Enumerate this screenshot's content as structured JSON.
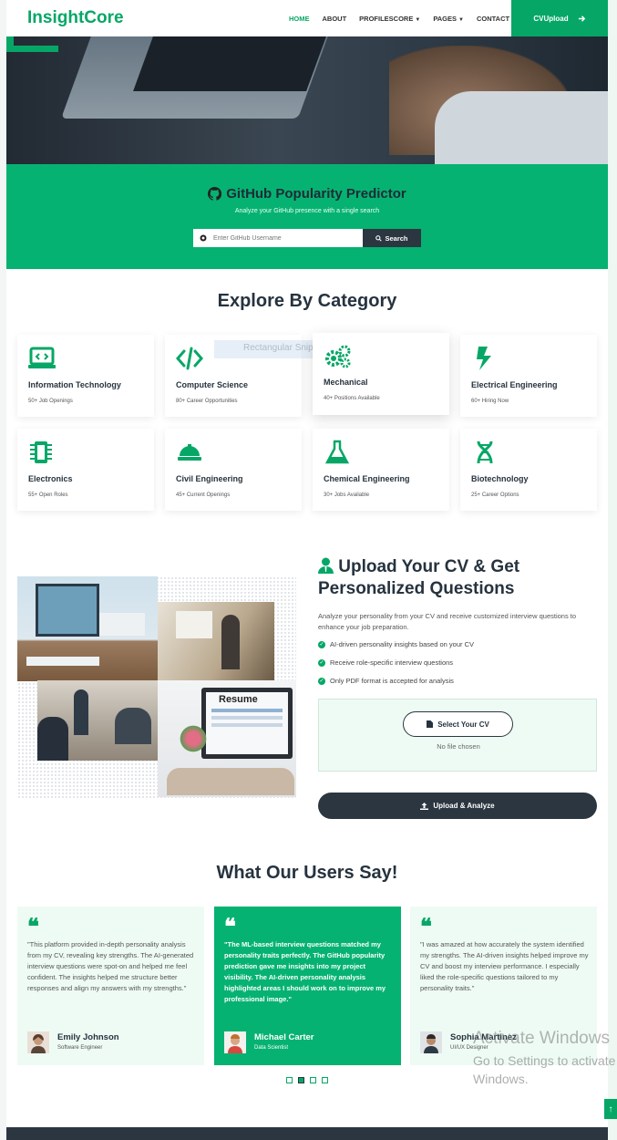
{
  "brand": "InsightCore",
  "nav": {
    "items": [
      "HOME",
      "ABOUT",
      "PROFILESCORE",
      "PAGES",
      "CONTACT"
    ],
    "cv_upload": "CVUpload"
  },
  "github": {
    "title": "GitHub Popularity Predictor",
    "subtitle": "Analyze your GitHub presence with a single search",
    "placeholder": "Enter GitHub Username",
    "search_label": "Search"
  },
  "categories": {
    "title": "Explore By Category",
    "ghost_text": "Rectangular Snip",
    "items": [
      {
        "title": "Information Technology",
        "subtitle": "50+ Job Openings",
        "icon": "laptop-code-icon"
      },
      {
        "title": "Computer Science",
        "subtitle": "80+ Career Opportunities",
        "icon": "code-icon"
      },
      {
        "title": "Mechanical",
        "subtitle": "40+ Positions Available",
        "icon": "gears-icon"
      },
      {
        "title": "Electrical Engineering",
        "subtitle": "60+ Hiring Now",
        "icon": "bolt-icon"
      },
      {
        "title": "Electronics",
        "subtitle": "55+ Open Roles",
        "icon": "microchip-icon"
      },
      {
        "title": "Civil Engineering",
        "subtitle": "45+ Current Openings",
        "icon": "hard-hat-icon"
      },
      {
        "title": "Chemical Engineering",
        "subtitle": "30+ Jobs Available",
        "icon": "flask-icon"
      },
      {
        "title": "Biotechnology",
        "subtitle": "25+ Career Options",
        "icon": "dna-icon"
      }
    ]
  },
  "upload": {
    "title": "Upload Your CV & Get Personalized Questions",
    "description": "Analyze your personality from your CV and receive customized interview questions to enhance your job preparation.",
    "checks": [
      "AI-driven personality insights based on your CV",
      "Receive role-specific interview questions",
      "Only PDF format is accepted for analysis"
    ],
    "select_label": "Select Your CV",
    "no_file": "No file chosen",
    "analyze_label": "Upload & Analyze",
    "resume_label": "Resume"
  },
  "testimonials": {
    "title": "What Our Users Say!",
    "items": [
      {
        "text": "\"This platform provided in-depth personality analysis from my CV, revealing key strengths. The AI-generated interview questions were spot-on and helped me feel confident. The insights helped me structure better responses and align my answers with my strengths.\"",
        "name": "Emily Johnson",
        "role": "Software Engineer"
      },
      {
        "text": "\"The ML-based interview questions matched my personality traits perfectly. The GitHub popularity prediction gave me insights into my project visibility. The AI-driven personality analysis highlighted areas I should work on to improve my professional image.\"",
        "name": "Michael Carter",
        "role": "Data Scientist"
      },
      {
        "text": "\"I was amazed at how accurately the system identified my strengths. The AI-driven insights helped improve my CV and boost my interview performance. I especially liked the role-specific questions tailored to my personality traits.\"",
        "name": "Sophia Martinez",
        "role": "UI/UX Designer"
      }
    ]
  },
  "watermark": {
    "line1": "Activate Windows",
    "line2": "Go to Settings to activate Windows."
  },
  "colors": {
    "accent": "#06a766",
    "dark": "#2b3640",
    "light": "#eefbf4"
  }
}
